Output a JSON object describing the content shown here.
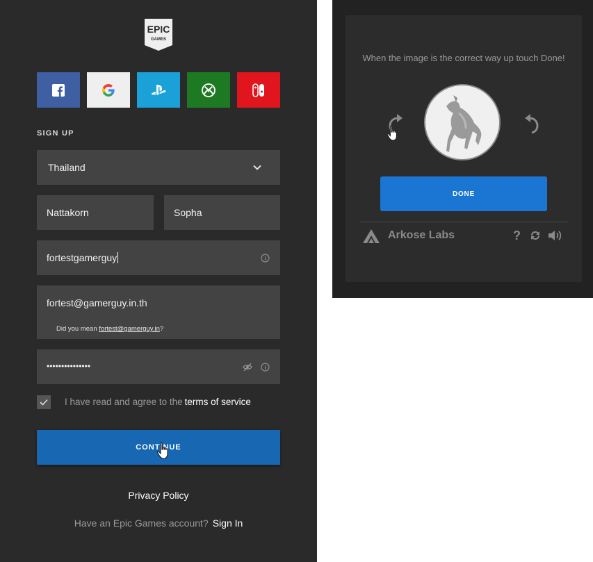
{
  "logo": {
    "line1": "EPIC",
    "line2": "GAMES"
  },
  "social": [
    {
      "name": "facebook"
    },
    {
      "name": "google"
    },
    {
      "name": "playstation"
    },
    {
      "name": "xbox"
    },
    {
      "name": "nintendo"
    }
  ],
  "form": {
    "section_label": "SIGN UP",
    "country": "Thailand",
    "first_name": "Nattakorn",
    "last_name": "Sopha",
    "display_name": "fortestgamerguy",
    "email": "fortest@gamerguy.in.th",
    "email_suggestion_prefix": "Did you mean ",
    "email_suggestion": "fortest@gamerguy.in",
    "email_suggestion_suffix": "?",
    "password": "•••••••••••••••",
    "terms_text": "I have read and agree to the",
    "terms_link": "terms of service",
    "terms_checked": true,
    "continue_label": "CONTINUE"
  },
  "footer": {
    "privacy": "Privacy Policy",
    "have_account": "Have an Epic Games account?",
    "sign_in": "Sign In"
  },
  "captcha": {
    "prompt": "When the image is the correct way up touch Done!",
    "done_label": "DONE",
    "brand": "Arkose Labs",
    "help": "?"
  },
  "colors": {
    "panel": "#2a2a2a",
    "field": "#434343",
    "continue": "#1767b3",
    "done": "#1a76d2"
  }
}
